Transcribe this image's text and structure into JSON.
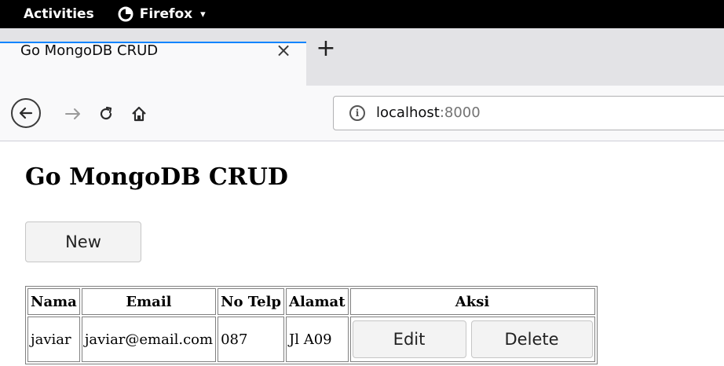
{
  "system_bar": {
    "activities_label": "Activities",
    "app_label": "Firefox",
    "app_menu_caret": "▾"
  },
  "browser": {
    "tab_title": "Go MongoDB CRUD",
    "tab_close_glyph": "×",
    "new_tab_glyph": "+",
    "url_host": "localhost",
    "url_port": ":8000",
    "accent_color": "#0a84ff"
  },
  "page": {
    "title": "Go MongoDB CRUD",
    "new_button_label": "New",
    "table": {
      "headers": [
        "Nama",
        "Email",
        "No Telp",
        "Alamat",
        "Aksi"
      ],
      "rows": [
        {
          "nama": "javiar",
          "email": "javiar@email.com",
          "no_telp": "087",
          "alamat": "Jl A09",
          "edit_label": "Edit",
          "delete_label": "Delete"
        }
      ]
    }
  }
}
